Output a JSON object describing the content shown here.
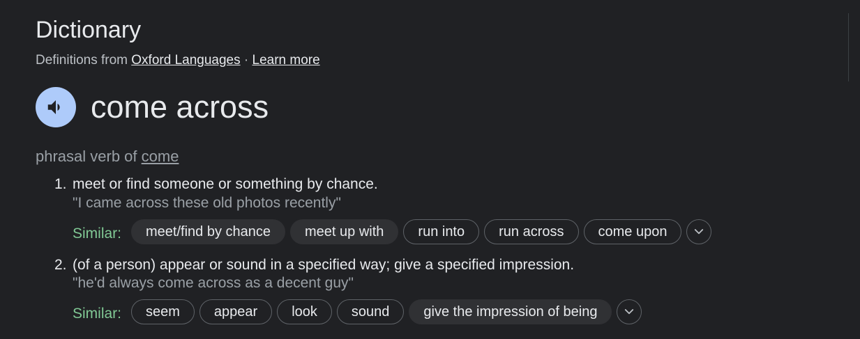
{
  "header": {
    "title": "Dictionary",
    "source_prefix": "Definitions from",
    "source_link": "Oxford Languages",
    "separator": "·",
    "learn_more": "Learn more"
  },
  "entry": {
    "word": "come across",
    "audio_icon": "speaker-icon",
    "pos_prefix": "phrasal verb of",
    "pos_link": "come"
  },
  "definitions": [
    {
      "number": "1.",
      "text": "meet or find someone or something by chance.",
      "example": "\"I came across these old photos recently\"",
      "similar_label": "Similar:",
      "similar": [
        "meet/find by chance",
        "meet up with",
        "run into",
        "run across",
        "come upon"
      ]
    },
    {
      "number": "2.",
      "text": "(of a person) appear or sound in a specified way; give a specified impression.",
      "example": "\"he'd always come across as a decent guy\"",
      "similar_label": "Similar:",
      "similar": [
        "seem",
        "appear",
        "look",
        "sound",
        "give the impression of being"
      ]
    }
  ],
  "colors": {
    "background": "#202124",
    "accent_audio": "#aecbfa",
    "similar_label": "#81c995",
    "muted_text": "#9aa0a6"
  }
}
